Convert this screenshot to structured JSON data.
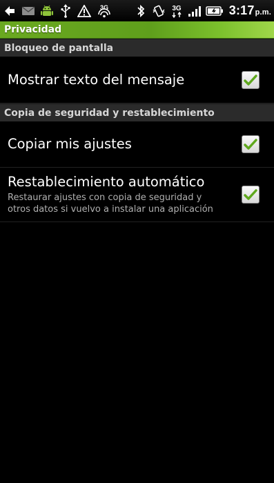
{
  "status_bar": {
    "time": "3:17",
    "ampm": "p.m.",
    "network_label": "3G",
    "tether_label": "3G",
    "icons_left": [
      "back-arrow-icon",
      "mail-icon",
      "android-icon",
      "usb-icon",
      "warning-icon",
      "wifi-3g-icon"
    ],
    "icons_right": [
      "bluetooth-icon",
      "vibrate-icon",
      "3g-data-icon",
      "signal-icon",
      "battery-icon"
    ]
  },
  "title_bar": {
    "title": "Privacidad"
  },
  "sections": [
    {
      "header": "Bloqueo de pantalla",
      "items": [
        {
          "title": "Mostrar texto del mensaje",
          "summary": "",
          "checked": true
        }
      ]
    },
    {
      "header": "Copia de seguridad y restablecimiento",
      "items": [
        {
          "title": "Copiar mis ajustes",
          "summary": "",
          "checked": true
        },
        {
          "title": "Restablecimiento automático",
          "summary": "Restaurar ajustes con copia de seguridad y otros datos si vuelvo a instalar una aplicación",
          "checked": true
        }
      ]
    }
  ],
  "colors": {
    "accent_green": "#6aa820",
    "check_green": "#5fa81d",
    "section_bg": "#2b2b2b",
    "background": "#000000"
  }
}
